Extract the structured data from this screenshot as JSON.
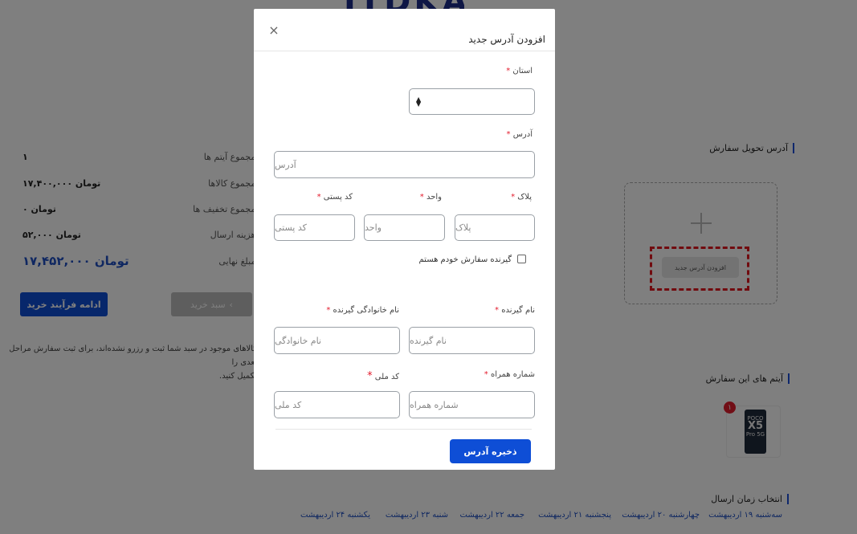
{
  "background": {
    "summary": [
      {
        "label": "مجموع آیتم ها:",
        "value": "۱"
      },
      {
        "label": "مجموع کالاها:",
        "value": "۱۷,۴۰۰,۰۰۰ تومان"
      },
      {
        "label": "مجموع تخفیف ها:",
        "value": "۰ تومان"
      },
      {
        "label": "هزینه ارسال:",
        "value": "۵۲,۰۰۰ تومان"
      },
      {
        "label": "مبلغ نهایی:",
        "value": "۱۷,۴۵۲,۰۰۰ تومان"
      }
    ],
    "continue_button": "ادامه فرآیند خرید",
    "back_button": "سبد خرید",
    "note_line1": "کالاهای موجود در سبد شما ثبت و رزرو نشده‌اند، برای ثبت سفارش مراحل بعدی را",
    "note_line2": "تکمیل کنید.",
    "delivery_address_title": "آدرس تحویل سفارش",
    "add_address_button": "افزودن آدرس جدید",
    "order_items_title": "آیتم های این سفارش",
    "item_count_badge": "۱",
    "product_text_top": "POCO",
    "product_text_mid": "X5",
    "product_text_bottom": "Pro 5G",
    "shipping_time_title": "انتخاب زمان ارسال",
    "days": [
      "سه‌شنبه ۱۹ اردیبهشت",
      "چهارشنبه ۲۰ اردیبهشت",
      "پنجشنبه ۲۱ اردیبهشت",
      "جمعه ۲۲ اردیبهشت",
      "شنبه ۲۳ اردیبهشت",
      "یکشنبه ۲۴ اردیبهشت"
    ]
  },
  "modal": {
    "title": "افزودن آدرس جدید",
    "close_icon": "×",
    "province_label": "استان",
    "address_label": "آدرس",
    "address_placeholder": "آدرس",
    "plaque_label": "پلاک",
    "plaque_placeholder": "پلاک",
    "unit_label": "واحد",
    "unit_placeholder": "واحد",
    "postal_label": "کد پستی",
    "postal_placeholder": "کد پستی",
    "self_receiver_label": "گیرنده سفارش خودم هستم",
    "receiver_name_label": "نام گیرنده",
    "receiver_name_placeholder": "نام گیرنده",
    "receiver_family_label": "نام خانوادگی گیرنده",
    "receiver_family_placeholder": "نام خانوادگی",
    "mobile_label": "شماره همراه",
    "mobile_placeholder": "شماره همراه",
    "national_code_label": "کد ملی",
    "national_code_placeholder": "کد ملی",
    "required_mark": "*",
    "save_button": "ذخیره آدرس"
  },
  "colors": {
    "primary": "#0e4ed6",
    "required": "#e31c2d",
    "highlight": "#e2161f"
  }
}
